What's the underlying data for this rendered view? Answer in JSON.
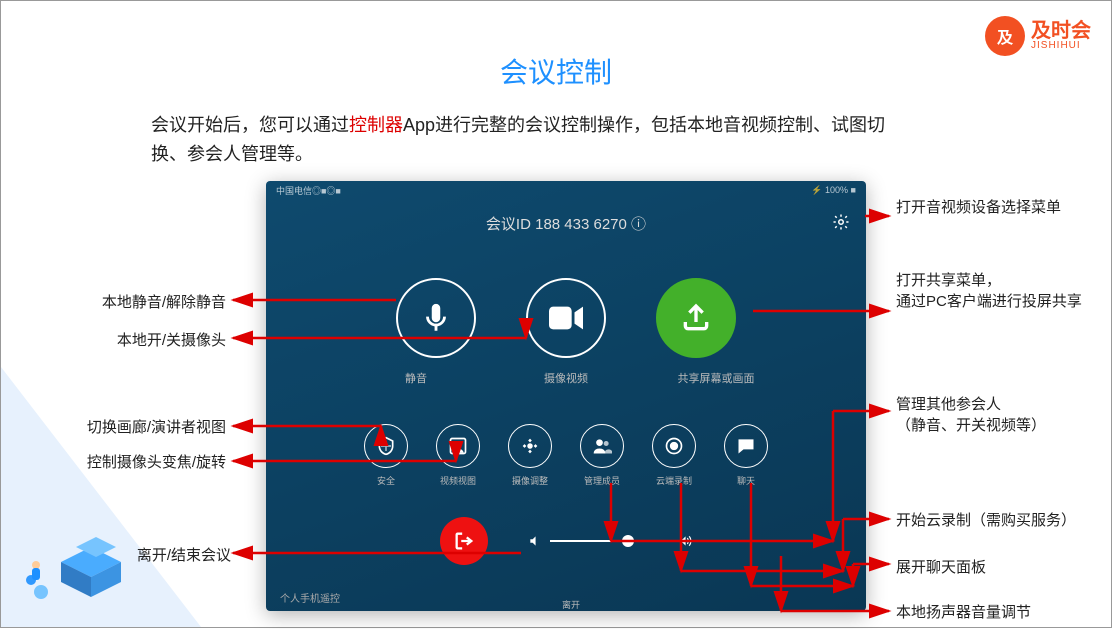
{
  "brand": {
    "cn": "及时会",
    "en": "JISHIHUI",
    "monogram": "及"
  },
  "title": "会议控制",
  "description_pre": "会议开始后，您可以通过",
  "description_hl": "控制器",
  "description_post": "App进行完整的会议控制操作，包括本地音视频控制、试图切换、参会人管理等。",
  "status_bar": {
    "left": "中国电信◎■◎■",
    "right": "⚡ 100% ■"
  },
  "meeting": {
    "id_label": "会议ID",
    "id": "188 433 6270",
    "info_symbol": "ⓘ"
  },
  "big_buttons": {
    "mute": {
      "label": "静音"
    },
    "video": {
      "label": "摄像视频"
    },
    "share": {
      "label": "共享屏幕或画面"
    }
  },
  "small_buttons": {
    "security": {
      "label": "安全"
    },
    "view": {
      "label": "视频视图"
    },
    "camera": {
      "label": "摄像调整"
    },
    "participants": {
      "label": "管理成员"
    },
    "record": {
      "label": "云端录制"
    },
    "chat": {
      "label": "聊天"
    }
  },
  "exit": {
    "label": "离开"
  },
  "foot_note": "个人手机遥控",
  "annotations": {
    "left": {
      "mute": "本地静音/解除静音",
      "camera_toggle": "本地开/关摄像头",
      "view_switch": "切换画廊/演讲者视图",
      "cam_adjust": "控制摄像头变焦/旋转",
      "leave": "离开/结束会议"
    },
    "right": {
      "settings": "打开音视频设备选择菜单",
      "share": "打开共享菜单，\n通过PC客户端进行投屏共享",
      "participants": "管理其他参会人\n（静音、开关视频等）",
      "record": "开始云录制（需购买服务）",
      "chat": "展开聊天面板",
      "volume": "本地扬声器音量调节"
    }
  }
}
